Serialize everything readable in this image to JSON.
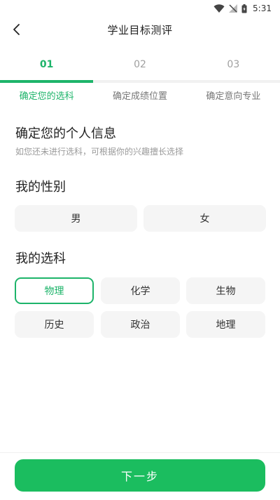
{
  "status_bar": {
    "time": "5:31"
  },
  "app_bar": {
    "title": "学业目标测评"
  },
  "steps": {
    "items": [
      "01",
      "02",
      "03"
    ],
    "labels": [
      "确定您的选科",
      "确定成绩位置",
      "确定意向专业"
    ],
    "active_index": 0,
    "progress_fraction": 0.333
  },
  "intro": {
    "title": "确定您的个人信息",
    "subtitle": "如您还未进行选科，可根据你的兴趣擅长选择"
  },
  "gender": {
    "title": "我的性别",
    "options": [
      "男",
      "女"
    ]
  },
  "subjects": {
    "title": "我的选科",
    "options": [
      "物理",
      "化学",
      "生物",
      "历史",
      "政治",
      "地理"
    ],
    "selected": "物理"
  },
  "footer": {
    "next_label": "下一步"
  },
  "colors": {
    "accent": "#1db46a",
    "button": "#1bbd5f"
  }
}
